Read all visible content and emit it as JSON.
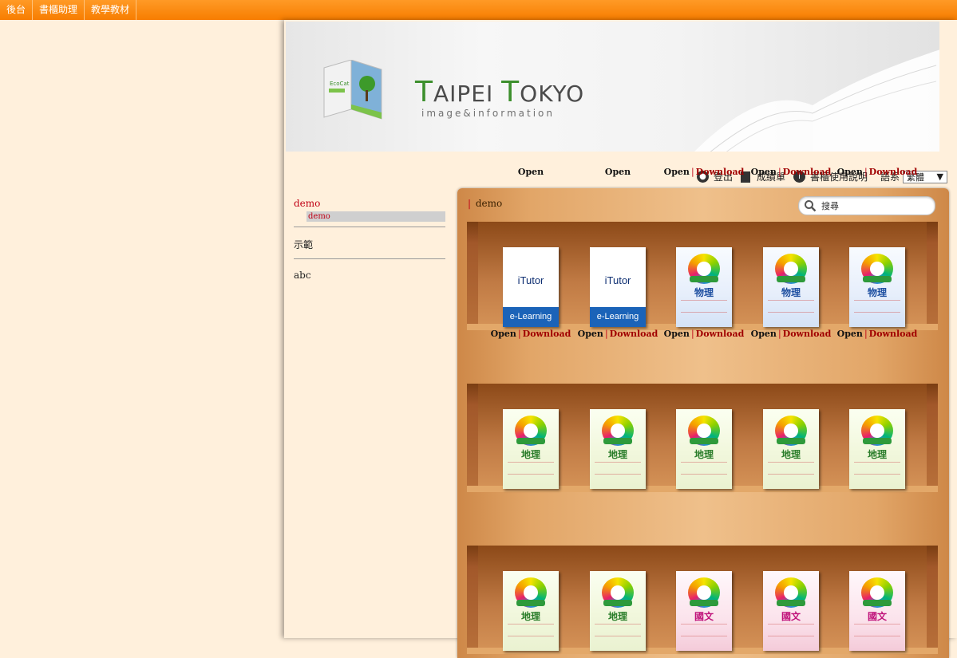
{
  "topnav": [
    "後台",
    "書櫃助理",
    "教學教材"
  ],
  "banner": {
    "brand_cap1": "T",
    "brand_rest1": "AIPEI",
    "brand_cap2": "T",
    "brand_rest2": "OKYO",
    "sub": "image&information",
    "mini_book_label": "EcoCat"
  },
  "toolbar": {
    "logout": "登出",
    "grades": "成績單",
    "help": "書櫃使用說明",
    "lang_label": "語系",
    "lang_value": "繁體"
  },
  "sidebar": {
    "cat1": "demo",
    "cat1_sub": "demo",
    "cat2": "示範",
    "cat3": "abc"
  },
  "shelf": {
    "title": "demo",
    "search_placeholder": "搜尋"
  },
  "links": {
    "open": "Open",
    "download": "Download"
  },
  "books": [
    [
      {
        "type": "itutor",
        "title": "iTutor",
        "band": "e-Learning",
        "download": false
      },
      {
        "type": "itutor",
        "title": "iTutor",
        "band": "e-Learning",
        "download": false
      },
      {
        "type": "ph",
        "subject": "物理",
        "download": true
      },
      {
        "type": "ph",
        "subject": "物理",
        "download": true
      },
      {
        "type": "ph",
        "subject": "物理",
        "download": true
      }
    ],
    [
      {
        "type": "ge",
        "subject": "地理",
        "download": true
      },
      {
        "type": "ge",
        "subject": "地理",
        "download": true
      },
      {
        "type": "ge",
        "subject": "地理",
        "download": true
      },
      {
        "type": "ge",
        "subject": "地理",
        "download": true
      },
      {
        "type": "ge",
        "subject": "地理",
        "download": true
      }
    ],
    [
      {
        "type": "ge",
        "subject": "地理"
      },
      {
        "type": "ge",
        "subject": "地理"
      },
      {
        "type": "ch",
        "subject": "國文"
      },
      {
        "type": "ch",
        "subject": "國文"
      },
      {
        "type": "ch",
        "subject": "國文"
      }
    ]
  ]
}
